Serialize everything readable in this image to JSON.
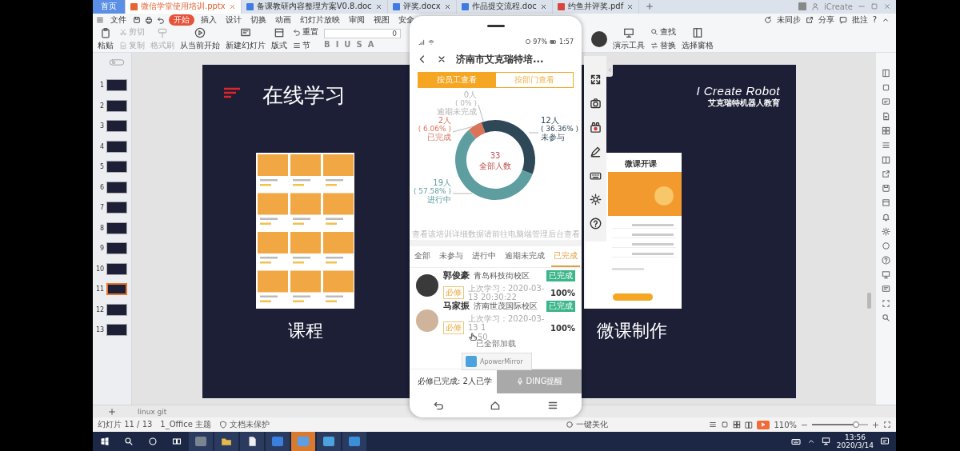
{
  "tabs": [
    {
      "label": "首页",
      "selected": false,
      "kind": "home"
    },
    {
      "label": "微信学堂使用培训.pptx",
      "selected": true,
      "kind": "ppt"
    },
    {
      "label": "备课教研内容整理方案V0.8.doc",
      "selected": false,
      "kind": "doc"
    },
    {
      "label": "评奖.docx",
      "selected": false,
      "kind": "doc"
    },
    {
      "label": "作品提交流程.doc",
      "selected": false,
      "kind": "doc"
    },
    {
      "label": "约鱼井评奖.pdf",
      "selected": false,
      "kind": "pdf"
    }
  ],
  "account": "iCreate",
  "menu": {
    "file": "文件",
    "items": [
      {
        "label": "开始",
        "selected": true
      },
      {
        "label": "插入",
        "selected": false
      },
      {
        "label": "设计",
        "selected": false
      },
      {
        "label": "切换",
        "selected": false
      },
      {
        "label": "动画",
        "selected": false
      },
      {
        "label": "幻灯片放映",
        "selected": false
      },
      {
        "label": "审阅",
        "selected": false
      },
      {
        "label": "视图",
        "selected": false
      },
      {
        "label": "安全",
        "selected": false
      }
    ],
    "right": [
      "未同步",
      "分享",
      "批注"
    ],
    "help": "?"
  },
  "ribbon": [
    {
      "kind": "large",
      "label": "粘贴",
      "disabled": false
    },
    {
      "kind": "stack",
      "items": [
        {
          "label": "剪切",
          "disabled": true
        },
        {
          "label": "复制",
          "disabled": true
        }
      ]
    },
    {
      "kind": "large",
      "label": "格式刷",
      "disabled": true
    },
    {
      "kind": "large",
      "label": "从当前开始",
      "disabled": false
    },
    {
      "kind": "large",
      "label": "新建幻灯片",
      "disabled": false
    },
    {
      "kind": "large",
      "label": "版式",
      "disabled": false
    },
    {
      "kind": "stack",
      "items": [
        {
          "label": "重置",
          "disabled": false
        },
        {
          "label": "节",
          "disabled": false
        }
      ]
    },
    {
      "kind": "font",
      "value": "0",
      "buttons": [
        "B",
        "I",
        "U",
        "S",
        "A"
      ]
    }
  ],
  "ribbon_right": [
    {
      "kind": "large",
      "label": "演示工具",
      "disabled": false
    },
    {
      "kind": "stack",
      "items": [
        {
          "label": "查找",
          "disabled": false
        },
        {
          "label": "替换",
          "disabled": false
        }
      ]
    },
    {
      "kind": "large",
      "label": "选择窗格",
      "disabled": false
    }
  ],
  "slides": [
    {
      "number": "1",
      "selected": false
    },
    {
      "number": "2",
      "selected": false
    },
    {
      "number": "3",
      "selected": false
    },
    {
      "number": "4",
      "selected": false
    },
    {
      "number": "5",
      "selected": false
    },
    {
      "number": "6",
      "selected": false
    },
    {
      "number": "7",
      "selected": false
    },
    {
      "number": "8",
      "selected": false
    },
    {
      "number": "9",
      "selected": false
    },
    {
      "number": "10",
      "selected": false
    },
    {
      "number": "11",
      "selected": true
    },
    {
      "number": "12",
      "selected": false
    },
    {
      "number": "13",
      "selected": false
    }
  ],
  "slide": {
    "title": "在线学习",
    "logo": "I Create Robot",
    "logo_sub": "艾克瑞特机器人教育",
    "captions": [
      "课程",
      "微课制作"
    ],
    "app_screen_title": "微课开课"
  },
  "notes": "linux git",
  "status_bar": {
    "slide_counter": "幻灯片 11 / 13",
    "theme": "1_Office 主题",
    "protection": "文档未保护",
    "beautify": "一键美化",
    "zoom": "110%",
    "zoom_slider": {
      "level": 0.78
    }
  },
  "taskbar": {
    "time": "13:56",
    "date": "2020/3/14"
  },
  "phone": {
    "battery": "97%",
    "time": "1:57",
    "title": "济南市艾克瑞特培...",
    "view_toggle": [
      {
        "label": "按员工查看",
        "selected": true
      },
      {
        "label": "按部门查看",
        "selected": false
      }
    ],
    "chart": {
      "center_value": "33",
      "center_label": "全部人数",
      "slices": [
        {
          "count": "0人",
          "percent": "( 0% )",
          "color": "#b4b4b4"
        },
        {
          "count": "2人",
          "percent": "( 6.06% )",
          "color": "#d9735a"
        },
        {
          "count": "12人",
          "percent": "( 36.36% )",
          "color": "#2f4858"
        },
        {
          "count": "19人",
          "percent": "( 57.58% )",
          "color": "#5f9ea0"
        }
      ],
      "chart_data": {
        "type": "donut",
        "categories": [
          "逾期未完成",
          "已完成",
          "未参与",
          "进行中"
        ],
        "series": [
          {
            "values": [
              0,
              6.06,
              36.36,
              57.58
            ]
          }
        ]
      }
    },
    "note": "查看该培训详细数据请前往电脑端管理后台查看",
    "filters": [
      {
        "label": "全部",
        "selected": false
      },
      {
        "label": "未参与",
        "selected": false
      },
      {
        "label": "进行中",
        "selected": false
      },
      {
        "label": "逾期未完成",
        "selected": false
      },
      {
        "label": "已完成",
        "selected": true
      }
    ],
    "learners": [
      {
        "name": "郭俊豪",
        "campus": "青岛科技街校区",
        "status": "已完成",
        "tag": "必修",
        "last_study": "上次学习：2020-03-13 20:30:22",
        "progress": "100%"
      },
      {
        "name": "马家振",
        "campus": "济南世茂国际校区",
        "status": "已完成",
        "tag": "必修",
        "last_study": "上次学习：2020-03-13 1",
        "last_study_tail": "50",
        "progress": "100%"
      }
    ],
    "loaded": "已全部加载",
    "summary": "必修已完成: 2人已学",
    "remind_button": {
      "label": "DING提醒",
      "disabled": true
    },
    "toast": "ApowerMirror"
  }
}
